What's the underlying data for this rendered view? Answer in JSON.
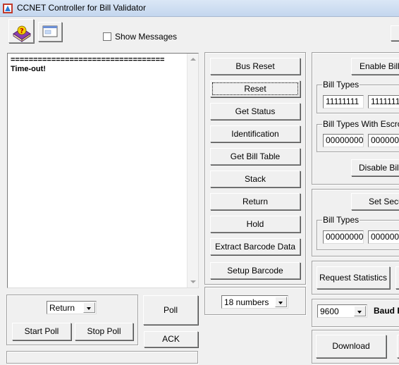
{
  "window": {
    "title": "CCNET Controller for Bill Validator"
  },
  "toolbar": {
    "show_messages_label": "Show Messages",
    "show_messages_checked": false
  },
  "log": {
    "lines": "==================================\nTime-out!"
  },
  "commands": {
    "bus_reset": "Bus Reset",
    "reset": "Reset",
    "get_status": "Get Status",
    "identification": "Identification",
    "get_bill_table": "Get Bill Table",
    "stack": "Stack",
    "return": "Return",
    "hold": "Hold",
    "extract_barcode": "Extract Barcode Data",
    "setup_barcode": "Setup Barcode",
    "barcode_format_selected": "18 numbers"
  },
  "poll": {
    "mode_selected": "Return",
    "start_poll": "Start Poll",
    "stop_poll": "Stop Poll",
    "poll": "Poll",
    "ack": "ACK"
  },
  "right": {
    "enable_bill_types": "Enable Bill T",
    "bill_types_label": "Bill Types",
    "bill_types_1": "11111111",
    "bill_types_2": "1111111",
    "escrow_label": "Bill Types With Escrow",
    "escrow_1": "00000000",
    "escrow_2": "0000000",
    "disable_bill": "Disable Bill T",
    "set_security": "Set Secu",
    "security_bill_types_label": "Bill Types",
    "security_1": "00000000",
    "security_2": "0000000",
    "request_statistics": "Request Statistics",
    "baud_selected": "9600",
    "baud_label": "Baud R",
    "download": "Download"
  }
}
